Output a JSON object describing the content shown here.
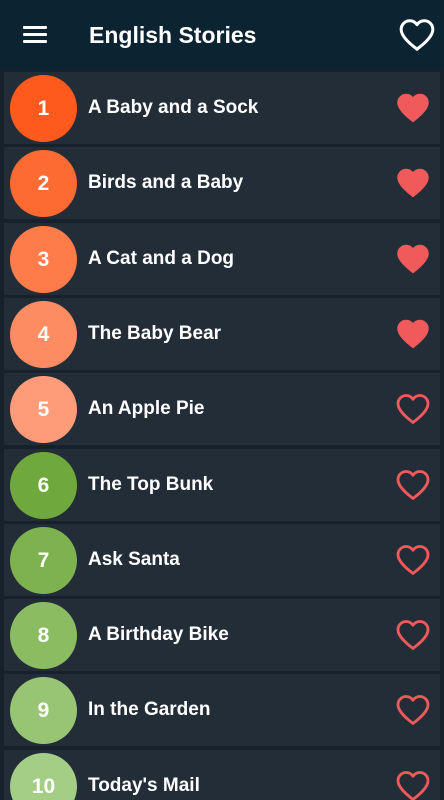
{
  "app": {
    "title": "English Stories"
  },
  "toolbar": {
    "menu_icon": "hamburger-menu-icon",
    "favorites_icon": "heart-outline-icon"
  },
  "colors": {
    "toolbar_bg": "#0c2431",
    "page_bg": "#16212b",
    "row_bg": "#232d38",
    "heart": "#f05a5a"
  },
  "stories": [
    {
      "number": "1",
      "title": "A Baby and a Sock",
      "favorite": true,
      "badge_color": "#fe5a1d"
    },
    {
      "number": "2",
      "title": "Birds and a Baby",
      "favorite": true,
      "badge_color": "#fe6b32"
    },
    {
      "number": "3",
      "title": "A Cat and a Dog",
      "favorite": true,
      "badge_color": "#fe7b4a"
    },
    {
      "number": "4",
      "title": "The Baby Bear",
      "favorite": true,
      "badge_color": "#fe8c62"
    },
    {
      "number": "5",
      "title": "An Apple Pie",
      "favorite": false,
      "badge_color": "#fe9c79"
    },
    {
      "number": "6",
      "title": "The Top Bunk",
      "favorite": false,
      "badge_color": "#6fa83c"
    },
    {
      "number": "7",
      "title": "Ask Santa",
      "favorite": false,
      "badge_color": "#7db24e"
    },
    {
      "number": "8",
      "title": "A Birthday Bike",
      "favorite": false,
      "badge_color": "#8bbc61"
    },
    {
      "number": "9",
      "title": "In the Garden",
      "favorite": false,
      "badge_color": "#98c574"
    },
    {
      "number": "10",
      "title": "Today's Mail",
      "favorite": false,
      "badge_color": "#a4cd86"
    }
  ]
}
